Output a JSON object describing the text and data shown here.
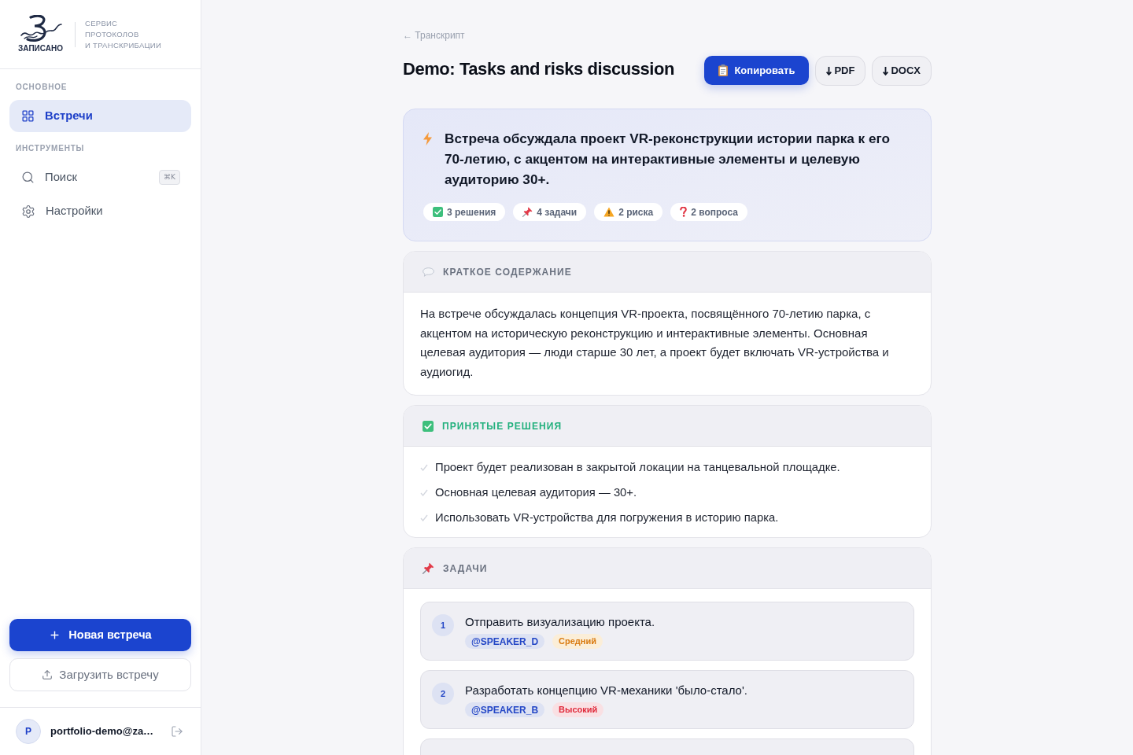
{
  "sidebar": {
    "logo": {
      "wordmark": "ЗАПИСАНО",
      "tagline": [
        "СЕРВИС",
        "ПРОТОКОЛОВ",
        "И ТРАНСКРИБАЦИИ"
      ]
    },
    "sections": [
      {
        "title": "ОСНОВНОЕ",
        "items": [
          {
            "kind": "grid",
            "label": "Встречи",
            "selected": true
          }
        ]
      },
      {
        "title": "ИНСТРУМЕНТЫ",
        "items": [
          {
            "kind": "search",
            "label": "Поиск",
            "selected": false,
            "shortcut": "⌘K"
          },
          {
            "kind": "settings",
            "label": "Настройки",
            "selected": false
          }
        ]
      }
    ],
    "new_button": "Новая встреча",
    "upload_button": "Загрузить встречу",
    "user": {
      "initial": "P",
      "email": "portfolio-demo@za…"
    }
  },
  "header": {
    "back_link": "← Транскрипт",
    "title": "Demo: Tasks and risks discussion",
    "actions": [
      {
        "kind": "copy",
        "label": "Копировать"
      },
      {
        "kind": "download",
        "label": "PDF"
      },
      {
        "kind": "download",
        "label": "DOCX"
      }
    ]
  },
  "highlight": {
    "text": "Встреча обсуждала проект VR-реконструкции истории парка к его 70-летию, с акцентом на интерактивные элементы и целевую аудиторию 30+.",
    "stats": [
      {
        "kind": "decisions",
        "label": "3 решения"
      },
      {
        "kind": "tasks",
        "label": "4 задачи"
      },
      {
        "kind": "risks",
        "label": "2 риска"
      },
      {
        "kind": "questions",
        "label": "2 вопроса"
      }
    ]
  },
  "sections": [
    {
      "kind": "summary",
      "title": "КРАТКОЕ СОДЕРЖАНИЕ",
      "text": "На встрече обсуждалась концепция VR-проекта, посвящённого 70-летию парка, с акцентом на историческую реконструкцию и интерактивные элементы. Основная целевая аудитория — люди старше 30 лет, а проект будет включать VR-устройства и аудиогид."
    },
    {
      "kind": "decisions",
      "title": "ПРИНЯТЫЕ РЕШЕНИЯ",
      "items": [
        "Проект будет реализован в закрытой локации на танцевальной площадке.",
        "Основная целевая аудитория — 30+.",
        "Использовать VR-устройства для погружения в историю парка."
      ]
    },
    {
      "kind": "tasks",
      "title": "ЗАДАЧИ",
      "items": [
        {
          "number": "1",
          "text": "Отправить визуализацию проекта.",
          "assignee": "@SPEAKER_D",
          "priority": {
            "kind": "medium",
            "label": "Средний"
          }
        },
        {
          "number": "2",
          "text": "Разработать концепцию VR-механики 'было-стало'.",
          "assignee": "@SPEAKER_B",
          "priority": {
            "kind": "high",
            "label": "Высокий"
          }
        }
      ],
      "more_below": true
    }
  ]
}
